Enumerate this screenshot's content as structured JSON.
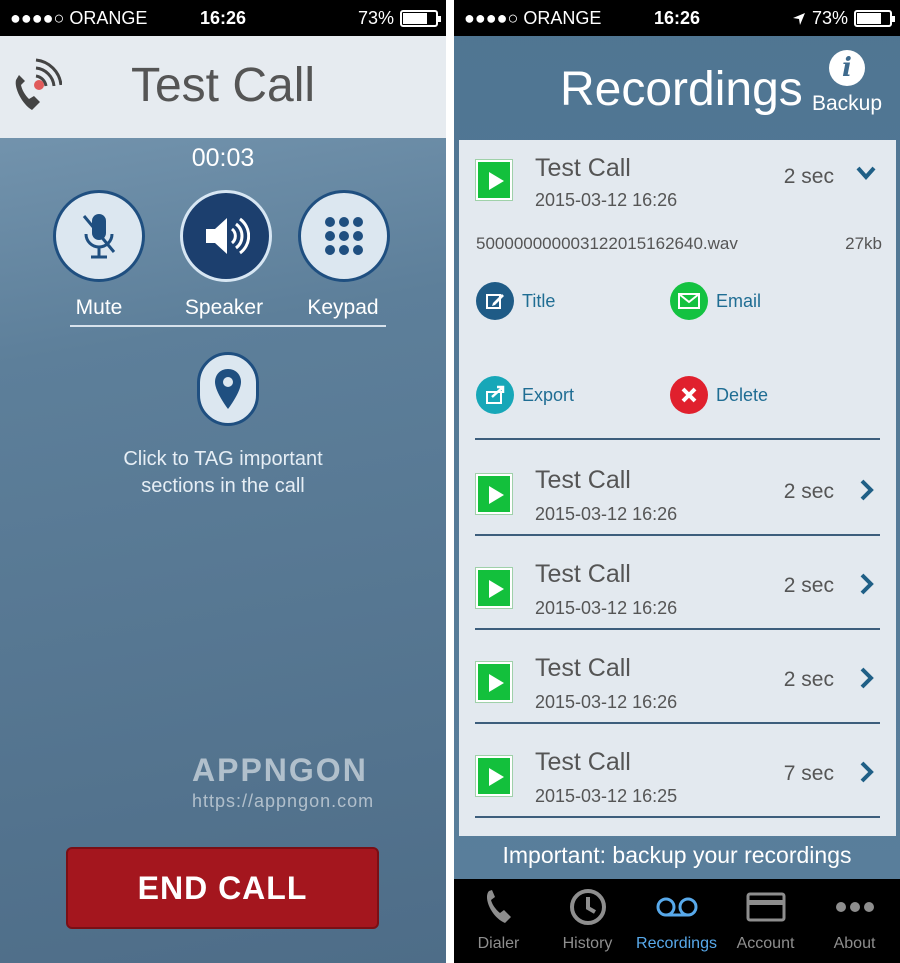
{
  "left": {
    "status": {
      "carrier": "●●●●○ ORANGE",
      "time": "16:26",
      "battery": "73%"
    },
    "header": {
      "title": "Test Call",
      "icon": "phone-icon"
    },
    "timer": "00:03",
    "controls": [
      {
        "label": "Mute",
        "icon": "microphone-muted-icon",
        "active": false
      },
      {
        "label": "Speaker",
        "icon": "speaker-icon",
        "active": true
      },
      {
        "label": "Keypad",
        "icon": "keypad-icon",
        "active": false
      }
    ],
    "tag": {
      "icon": "location-pin-icon",
      "hint_line1": "Click to TAG important",
      "hint_line2": "sections in the call"
    },
    "watermark": {
      "brand": "APPNGON",
      "url": "https://appngon.com"
    },
    "end_call_label": "END CALL"
  },
  "right": {
    "status": {
      "carrier": "●●●●○ ORANGE",
      "time": "16:26",
      "battery": "73%"
    },
    "header": {
      "title": "Recordings",
      "backup_label": "Backup",
      "info_glyph": "i"
    },
    "expanded": {
      "title": "Test Call",
      "date": "2015-03-12 16:26",
      "duration": "2 sec",
      "filename": "500000000003122015162640.wav",
      "size": "27kb",
      "actions": [
        {
          "label": "Title",
          "icon": "edit-icon",
          "color": "#1f5b86"
        },
        {
          "label": "Email",
          "icon": "email-icon",
          "color": "#14c241"
        },
        {
          "label": "Export",
          "icon": "export-icon",
          "color": "#17a7b8"
        },
        {
          "label": "Delete",
          "icon": "delete-icon",
          "color": "#e0202d"
        }
      ]
    },
    "recordings": [
      {
        "title": "Test Call",
        "date": "2015-03-12 16:26",
        "duration": "2 sec"
      },
      {
        "title": "Test Call",
        "date": "2015-03-12 16:26",
        "duration": "2 sec"
      },
      {
        "title": "Test Call",
        "date": "2015-03-12 16:26",
        "duration": "2 sec"
      },
      {
        "title": "Test Call",
        "date": "2015-03-12 16:25",
        "duration": "7 sec"
      }
    ],
    "notice": "Important: backup your recordings",
    "tabs": [
      {
        "label": "Dialer",
        "icon": "phone-icon",
        "active": false
      },
      {
        "label": "History",
        "icon": "clock-icon",
        "active": false
      },
      {
        "label": "Recordings",
        "icon": "voicemail-icon",
        "active": true
      },
      {
        "label": "Account",
        "icon": "credit-card-icon",
        "active": false
      },
      {
        "label": "About",
        "icon": "more-icon",
        "active": false
      }
    ]
  }
}
